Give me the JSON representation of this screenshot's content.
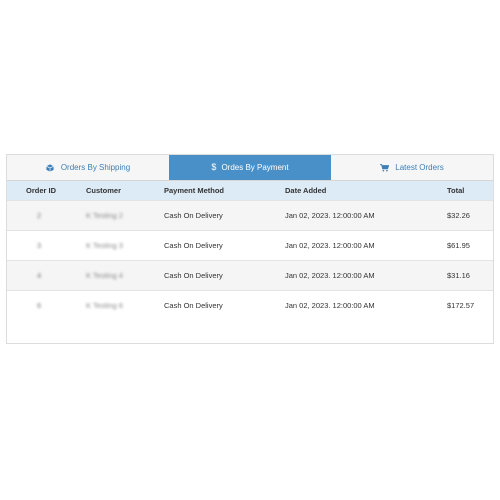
{
  "tabs": [
    {
      "label": "Orders By Shipping",
      "icon": "box-icon",
      "active": false
    },
    {
      "label": "Ordes By Payment",
      "icon": "dollar-icon",
      "active": true
    },
    {
      "label": "Latest Orders",
      "icon": "cart-icon",
      "active": false
    }
  ],
  "table": {
    "headers": {
      "order_id": "Order ID",
      "customer": "Customer",
      "payment_method": "Payment Method",
      "date_added": "Date Added",
      "total": "Total"
    },
    "rows": [
      {
        "order_id": "2",
        "customer": "K Testing 2",
        "payment_method": "Cash On Delivery",
        "date_added": "Jan 02, 2023. 12:00:00 AM",
        "total": "$32.26"
      },
      {
        "order_id": "3",
        "customer": "K Testing 3",
        "payment_method": "Cash On Delivery",
        "date_added": "Jan 02, 2023. 12:00:00 AM",
        "total": "$61.95"
      },
      {
        "order_id": "4",
        "customer": "K Testing 4",
        "payment_method": "Cash On Delivery",
        "date_added": "Jan 02, 2023. 12:00:00 AM",
        "total": "$31.16"
      },
      {
        "order_id": "6",
        "customer": "K Testing 6",
        "payment_method": "Cash On Delivery",
        "date_added": "Jan 02, 2023. 12:00:00 AM",
        "total": "$172.57"
      }
    ]
  },
  "colors": {
    "active_tab": "#4a90c8",
    "tab_text": "#3d7fb8",
    "header_row": "#ddebf6"
  }
}
